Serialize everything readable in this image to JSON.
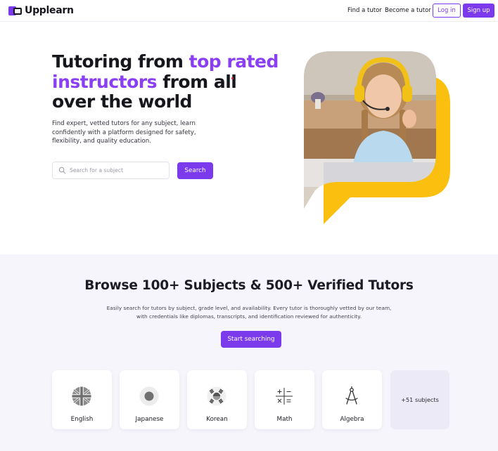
{
  "header": {
    "brand": "Upplearn",
    "nav": {
      "find_tutor": "Find a tutor",
      "become_tutor": "Become a tutor"
    },
    "login_label": "Log in",
    "signup_label": "Sign up"
  },
  "hero": {
    "title_part1": "Tutoring from ",
    "title_accent": "top rated instructors",
    "title_part2": " from all over the world",
    "subtitle": "Find expert, vetted tutors for any subject, learn confidently with a platform designed for safety, flexibility, and quality education.",
    "search_placeholder": "Search for a subject",
    "search_button": "Search"
  },
  "subjects_section": {
    "title": "Browse 100+ Subjects & 500+ Verified Tutors",
    "subtitle": "Easily search for tutors by subject, grade level, and availability. Every tutor is thoroughly vetted by our team, with credentials like diplomas, transcripts, and identification reviewed for authenticity.",
    "start_button": "Start searching",
    "subjects": [
      {
        "label": "English",
        "icon": "uk-flag-icon"
      },
      {
        "label": "Japanese",
        "icon": "japan-flag-icon"
      },
      {
        "label": "Korean",
        "icon": "korea-flag-icon"
      },
      {
        "label": "Math",
        "icon": "math-symbols-icon"
      },
      {
        "label": "Algebra",
        "icon": "compass-icon"
      }
    ],
    "more_label": "+51 subjects"
  },
  "colors": {
    "brand_purple": "#7c3aed",
    "accent_text": "#8b3ff5",
    "speech_bubble_yellow": "#fbbf0f",
    "section_bg": "#f6f5fb"
  }
}
